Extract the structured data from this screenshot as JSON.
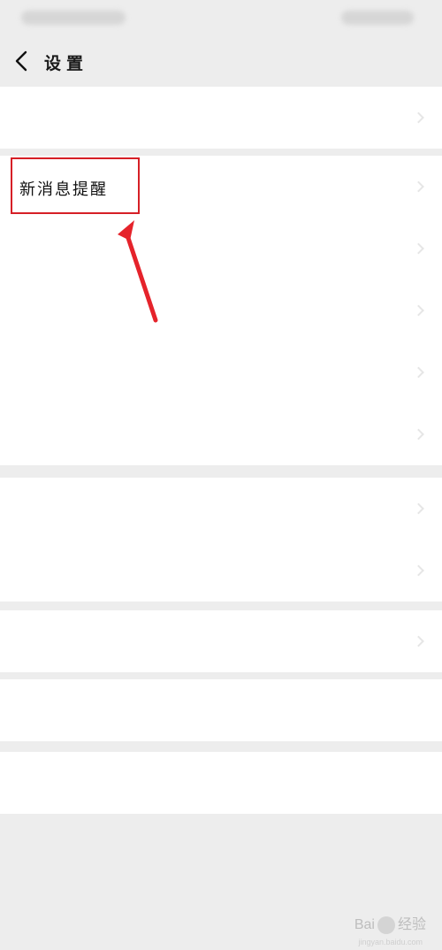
{
  "status_bar": {},
  "header": {
    "title": "设置"
  },
  "groups": [
    {
      "rows": [
        {
          "label": ""
        }
      ]
    },
    {
      "rows": [
        {
          "label": "新消息提醒",
          "highlighted": true
        },
        {
          "label": ""
        },
        {
          "label": ""
        },
        {
          "label": ""
        },
        {
          "label": ""
        }
      ]
    },
    {
      "rows": [
        {
          "label": ""
        },
        {
          "label": ""
        }
      ]
    },
    {
      "rows": [
        {
          "label": ""
        }
      ]
    }
  ],
  "bottom_actions": [
    {
      "label": ""
    },
    {
      "label": ""
    }
  ],
  "annotation": {
    "box_color": "#d61f26",
    "arrow_color": "#e5232b"
  },
  "watermark": {
    "text_left": "Bai",
    "text_right": "经验",
    "sub": "jingyan.baidu.com"
  }
}
